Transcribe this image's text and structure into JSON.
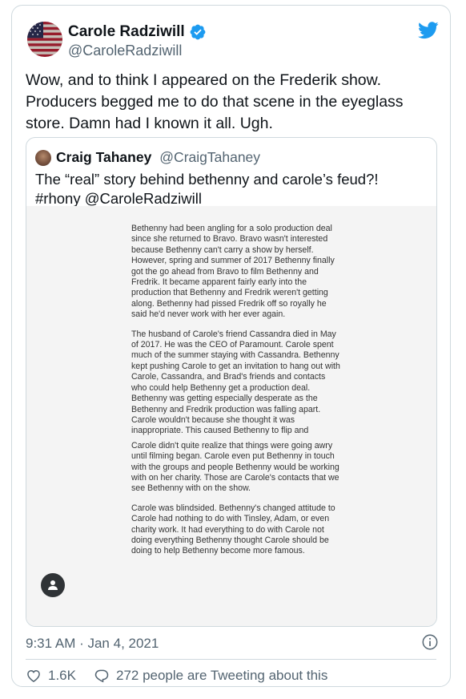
{
  "colors": {
    "accent": "#1d9bf0",
    "text": "#0f1419",
    "muted": "#536471",
    "border": "#cfd9de"
  },
  "author": {
    "display_name": "Carole Radziwill",
    "handle": "@CaroleRadziwill",
    "verified_icon": "verified-badge-icon",
    "avatar_icon": "us-flag-avatar"
  },
  "brand_icon": "twitter-bird-icon",
  "tweet": {
    "text": "Wow, and to think I appeared on the Frederik show. Producers begged me to do that scene in the eyeglass store. Damn had I known it all. Ugh."
  },
  "quoted": {
    "display_name": "Craig Tahaney",
    "handle": "@CraigTahaney",
    "text": "The “real” story behind bethenny and carole’s feud?! #rhony @CaroleRadziwill",
    "image_text": [
      "Bethenny had been angling for a solo production deal since she returned to Bravo. Bravo wasn't interested because Bethenny can't carry a show by herself. However, spring and summer of 2017 Bethenny finally got the go ahead from Bravo to film Bethenny and Fredrik. It became apparent fairly early into the production that Bethenny and Fredrik weren't getting along. Bethenny had pissed Fredrik off so royally he said he'd never work with her ever again.",
      "The husband of Carole's friend Cassandra died in May of 2017. He was the CEO of Paramount. Carole spent much of the summer staying with Cassandra. Bethenny kept pushing Carole to get an invitation to hang out with Carole, Cassandra, and Brad's friends and contacts who could help Bethenny get a production deal. Bethenny was getting especially desperate as the Bethenny and Fredrik production was falling apart. Carole wouldn't because she thought it was inappropriate. This caused Bethenny to flip and",
      "Carole didn't quite realize that things were going awry until filming began. Carole even put Bethenny in touch with the groups and people Bethenny would be working with on her charity. Those are Carole's contacts that we see Bethenny with on the show.",
      "Carole was blindsided. Bethenny's changed attitude to Carole had nothing to do with Tinsley, Adam, or even charity work. It had everything to do with Carole not doing everything Bethenny thought Carole should be doing to help Bethenny become more famous."
    ]
  },
  "timestamp": "9:31 AM · Jan 4, 2021",
  "actions": {
    "likes": "1.6K",
    "conversation": "272 people are Tweeting about this"
  }
}
